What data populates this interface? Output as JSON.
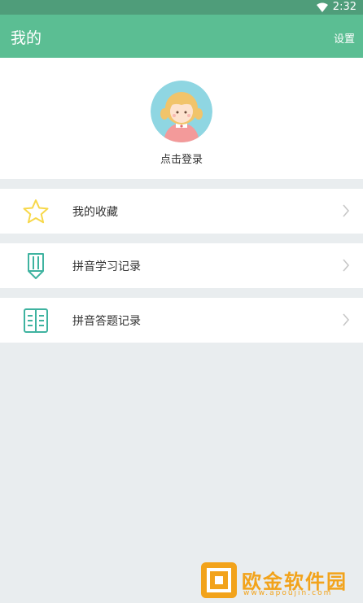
{
  "status_bar": {
    "time": "2:32",
    "wifi_icon": "wifi-icon"
  },
  "app_bar": {
    "title": "我的",
    "settings_label": "设置"
  },
  "profile": {
    "avatar_icon": "girl-avatar",
    "login_label": "点击登录"
  },
  "menu": [
    {
      "label": "我的收藏",
      "icon": "star-icon",
      "chevron": "chevron-right-icon"
    },
    {
      "label": "拼音学习记录",
      "icon": "pencil-bookmark-icon",
      "chevron": "chevron-right-icon"
    },
    {
      "label": "拼音答题记录",
      "icon": "list-document-icon",
      "chevron": "chevron-right-icon"
    }
  ],
  "watermark": {
    "text": "欧金软件园",
    "url": "www.apoujin.com"
  },
  "colors": {
    "accent": "#5bbe93",
    "status_bar": "#4f9d7a",
    "background": "#e9edef",
    "star": "#f7d84a",
    "icon_teal": "#3fb3a0",
    "watermark": "#f2a31b"
  }
}
